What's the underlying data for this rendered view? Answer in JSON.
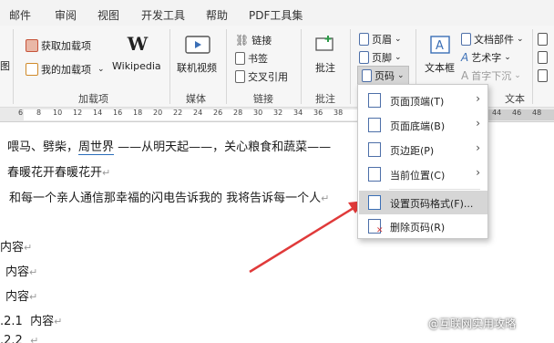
{
  "tabs": [
    "邮件",
    "审阅",
    "视图",
    "开发工具",
    "帮助",
    "PDF工具集"
  ],
  "ribbon": {
    "addins": {
      "get_addins": "获取加载项",
      "my_addins": "我的加载项",
      "wikipedia": "Wikipedia",
      "group_label": "加载项"
    },
    "media": {
      "online_video": "联机视频",
      "group_label": "媒体"
    },
    "links": {
      "link": "链接",
      "bookmark": "书签",
      "cross_ref": "交叉引用",
      "group_label": "链接"
    },
    "comments": {
      "comment": "批注",
      "group_label": "批注"
    },
    "header_footer": {
      "header": "页眉",
      "footer": "页脚",
      "page_number": "页码"
    },
    "text": {
      "textbox": "文本框",
      "doc_parts": "文档部件",
      "wordart": "艺术字",
      "dropcap": "首字下沉",
      "group_label": "文本"
    },
    "left_cut": "图"
  },
  "ruler_ticks": [
    "6",
    "8",
    "10",
    "12",
    "14",
    "16",
    "18",
    "20",
    "22",
    "24",
    "26",
    "28",
    "30",
    "32",
    "34",
    "36",
    "38",
    "40",
    "42",
    "44",
    "46",
    "48"
  ],
  "menu": {
    "items": [
      {
        "label": "页面顶端(T)",
        "has_sub": true
      },
      {
        "label": "页面底端(B)",
        "has_sub": true
      },
      {
        "label": "页边距(P)",
        "has_sub": true
      },
      {
        "label": "当前位置(C)",
        "has_sub": true
      },
      {
        "label": "设置页码格式(F)...",
        "has_sub": false,
        "highlighted": true
      },
      {
        "label": "删除页码(R)",
        "has_sub": false
      }
    ]
  },
  "document": {
    "line1": "喂马、劈柴，",
    "line1_link": "周世界",
    "line1_rest": " ——从明天起——，关心粮食和蔬菜——",
    "line2": "春暖花开春暖花开",
    "line3": "和每一个亲人通信那幸福的闪电告诉我的 我将告诉每一个人",
    "h1": "内容",
    "h2": "内容",
    "h3": "内容",
    "h4_num": ".2.1",
    "h4": "内容",
    "h5_num": ".2.2",
    "mark": "↵"
  },
  "watermark": "@互联网实用攻略",
  "colors": {
    "accent_red": "#e03a3a",
    "menu_highlight": "#d6d6d6",
    "icon_blue": "#4d6fa8"
  }
}
